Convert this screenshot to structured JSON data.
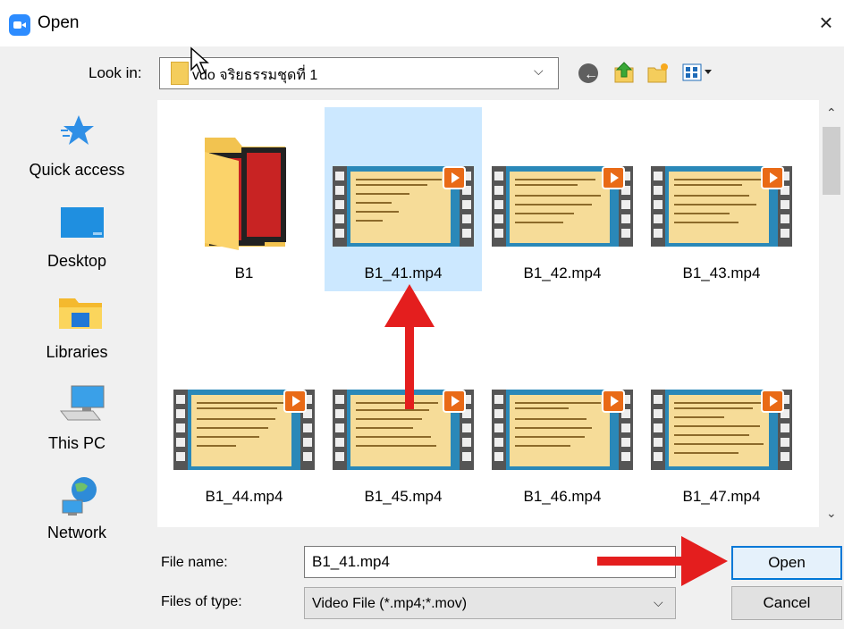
{
  "window": {
    "title": "Open",
    "close_glyph": "×"
  },
  "toolbar": {
    "look_in_label": "Look in:",
    "look_in_value": "vdo จริยธรรมชุดที่ 1",
    "chevron": "⌵",
    "back_glyph": "←"
  },
  "sidebar": {
    "items": [
      {
        "label": "Quick access",
        "icon": "star-icon"
      },
      {
        "label": "Desktop",
        "icon": "desktop-icon"
      },
      {
        "label": "Libraries",
        "icon": "libraries-icon"
      },
      {
        "label": "This PC",
        "icon": "computer-icon"
      },
      {
        "label": "Network",
        "icon": "network-icon"
      }
    ]
  },
  "files": {
    "items": [
      {
        "name": "B1",
        "type": "folder"
      },
      {
        "name": "B1_41.mp4",
        "type": "video",
        "selected": true
      },
      {
        "name": "B1_42.mp4",
        "type": "video"
      },
      {
        "name": "B1_43.mp4",
        "type": "video"
      },
      {
        "name": "B1_44.mp4",
        "type": "video"
      },
      {
        "name": "B1_45.mp4",
        "type": "video"
      },
      {
        "name": "B1_46.mp4",
        "type": "video"
      },
      {
        "name": "B1_47.mp4",
        "type": "video"
      }
    ]
  },
  "scrollbar": {
    "up_glyph": "⌃",
    "down_glyph": "⌄"
  },
  "form": {
    "file_name_label": "File name:",
    "file_name_value": "B1_41.mp4",
    "files_of_type_label": "Files of type:",
    "files_of_type_value": "Video File (*.mp4;*.mov)",
    "open_label": "Open",
    "cancel_label": "Cancel"
  },
  "colors": {
    "selection": "#cce8ff",
    "accent": "#0078d7",
    "annotation_arrow": "#e41e1e",
    "app_icon": "#2d8cff"
  }
}
